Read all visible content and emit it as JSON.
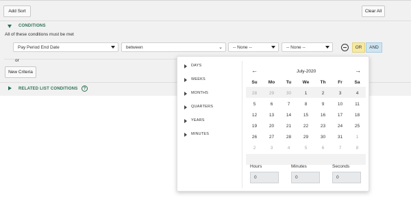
{
  "toolbar": {
    "add_sort": "Add Sort",
    "clear_all": "Clear All"
  },
  "conditions": {
    "title": "CONDITIONS",
    "subtitle": "All of these conditions must be met",
    "field": "Pay Period End Date",
    "operator": "between",
    "value1": "-- None --",
    "value2": "-- None --",
    "or_label": "OR",
    "and_label": "AND",
    "or_separator": "or",
    "new_criteria": "New Criteria",
    "related_title": "RELATED LIST CONDITIONS",
    "help_glyph": "?"
  },
  "picker": {
    "units": [
      "DAYS",
      "WEEKS",
      "MONTHS",
      "QUARTERS",
      "YEARS",
      "MINUTES"
    ],
    "month_label": "July-2020",
    "prev_glyph": "←",
    "next_glyph": "→",
    "weekdays": [
      "Su",
      "Mo",
      "Tu",
      "We",
      "Th",
      "Fr",
      "Sa"
    ],
    "weeks": [
      [
        "28",
        "29",
        "30",
        "1",
        "2",
        "3",
        "4"
      ],
      [
        "5",
        "6",
        "7",
        "8",
        "9",
        "10",
        "11"
      ],
      [
        "12",
        "13",
        "14",
        "15",
        "16",
        "17",
        "18"
      ],
      [
        "19",
        "20",
        "21",
        "22",
        "23",
        "24",
        "25"
      ],
      [
        "26",
        "27",
        "28",
        "29",
        "30",
        "31",
        "1"
      ],
      [
        "2",
        "3",
        "4",
        "5",
        "6",
        "7",
        "8"
      ]
    ],
    "hours_label": "Hours",
    "minutes_label": "Minutes",
    "seconds_label": "Seconds",
    "hours_value": "0",
    "minutes_value": "0",
    "seconds_value": "0"
  },
  "colors": {
    "section_green": "#2a6f52",
    "or_yellow": "#f6e9a2",
    "and_blue": "#cfe5f2"
  }
}
